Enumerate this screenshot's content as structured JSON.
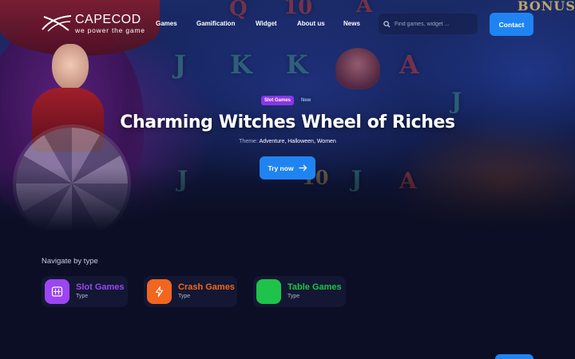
{
  "brand": {
    "name": "CAPECOD",
    "tagline": "we power the game"
  },
  "nav": {
    "items": [
      {
        "label": "Games"
      },
      {
        "label": "Gamification"
      },
      {
        "label": "Widget"
      },
      {
        "label": "About us"
      },
      {
        "label": "News"
      }
    ]
  },
  "search": {
    "placeholder": "Find games, widget ..."
  },
  "header": {
    "contact_label": "Contact"
  },
  "hero": {
    "tags": [
      {
        "label": "Slot Games",
        "color": "#8a35e6"
      },
      {
        "label": "New",
        "color": "#1b2c6a"
      }
    ],
    "title": "Charming Witches Wheel of Riches",
    "theme_label": "Theme:",
    "theme_values": "Adventure, Halloween, Women",
    "cta_label": "Try now",
    "background_art": {
      "bonus_text": "BONUS",
      "symbols": [
        "Q",
        "10",
        "A",
        "J",
        "K",
        "K",
        "A",
        "J",
        "A",
        "J",
        "J",
        "10"
      ]
    }
  },
  "navigate": {
    "title": "Navigate by type",
    "types": [
      {
        "name": "Slot Games",
        "sub": "Type",
        "color": "#9b46f2",
        "icon": "slot-machine-icon"
      },
      {
        "name": "Crash Games",
        "sub": "Type",
        "color": "#f2661e",
        "icon": "lightning-icon"
      },
      {
        "name": "Table Games",
        "sub": "Type",
        "color": "#1fc24a",
        "icon": "table-icon"
      }
    ]
  },
  "colors": {
    "accent": "#1f84f2",
    "background": "#0b0e24"
  }
}
